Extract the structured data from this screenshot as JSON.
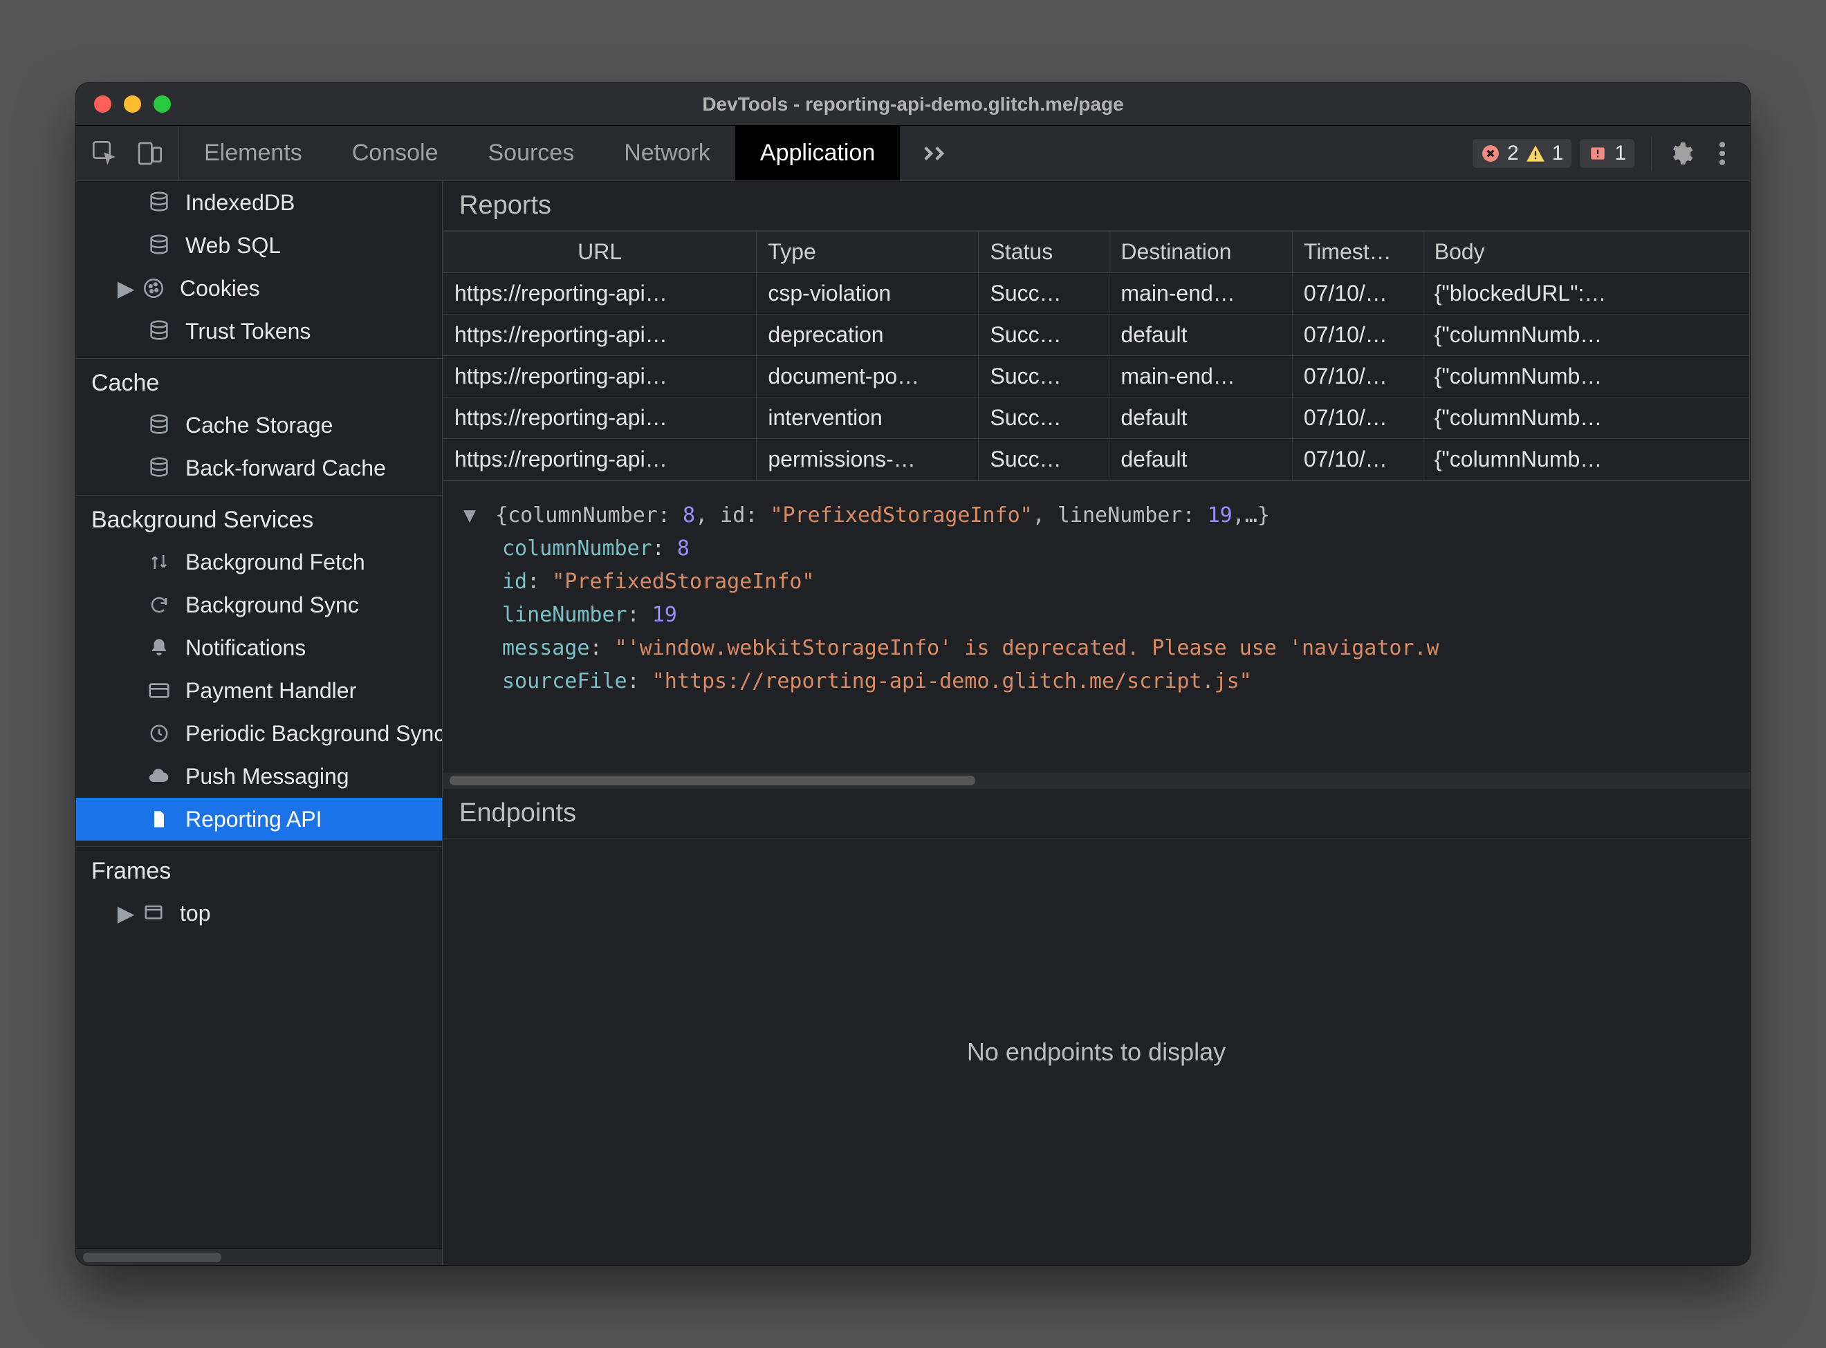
{
  "window": {
    "title": "DevTools - reporting-api-demo.glitch.me/page"
  },
  "toolbar": {
    "tabs": [
      "Elements",
      "Console",
      "Sources",
      "Network",
      "Application"
    ],
    "active_tab_index": 4,
    "errors_count": "2",
    "warnings_count": "1",
    "issues_count": "1"
  },
  "sidebar": {
    "storage_items": [
      {
        "icon": "database",
        "label": "IndexedDB",
        "level": 2
      },
      {
        "icon": "database",
        "label": "Web SQL",
        "level": 2
      },
      {
        "icon": "cookie",
        "label": "Cookies",
        "level": 2,
        "caret": true
      },
      {
        "icon": "database",
        "label": "Trust Tokens",
        "level": 2
      }
    ],
    "groups": [
      {
        "title": "Cache",
        "items": [
          {
            "icon": "database",
            "label": "Cache Storage"
          },
          {
            "icon": "database",
            "label": "Back-forward Cache"
          }
        ]
      },
      {
        "title": "Background Services",
        "items": [
          {
            "icon": "updown",
            "label": "Background Fetch"
          },
          {
            "icon": "sync",
            "label": "Background Sync"
          },
          {
            "icon": "bell",
            "label": "Notifications"
          },
          {
            "icon": "card",
            "label": "Payment Handler"
          },
          {
            "icon": "clock",
            "label": "Periodic Background Sync"
          },
          {
            "icon": "cloud",
            "label": "Push Messaging"
          },
          {
            "icon": "file",
            "label": "Reporting API",
            "selected": true
          }
        ]
      },
      {
        "title": "Frames",
        "items": [
          {
            "icon": "frame",
            "label": "top",
            "caret": true
          }
        ]
      }
    ]
  },
  "reports": {
    "title": "Reports",
    "columns": [
      "URL",
      "Type",
      "Status",
      "Destination",
      "Timest…",
      "Body"
    ],
    "rows": [
      {
        "url": "https://reporting-api…",
        "type": "csp-violation",
        "status": "Succ…",
        "destination": "main-end…",
        "timestamp": "07/10/…",
        "body": "{\"blockedURL\":…"
      },
      {
        "url": "https://reporting-api…",
        "type": "deprecation",
        "status": "Succ…",
        "destination": "default",
        "timestamp": "07/10/…",
        "body": "{\"columnNumb…"
      },
      {
        "url": "https://reporting-api…",
        "type": "document-po…",
        "status": "Succ…",
        "destination": "main-end…",
        "timestamp": "07/10/…",
        "body": "{\"columnNumb…"
      },
      {
        "url": "https://reporting-api…",
        "type": "intervention",
        "status": "Succ…",
        "destination": "default",
        "timestamp": "07/10/…",
        "body": "{\"columnNumb…"
      },
      {
        "url": "https://reporting-api…",
        "type": "permissions-…",
        "status": "Succ…",
        "destination": "default",
        "timestamp": "07/10/…",
        "body": "{\"columnNumb…"
      }
    ]
  },
  "detail": {
    "summary_prefix": "{columnNumber: ",
    "summary_col": "8",
    "summary_mid": ", id: ",
    "summary_id": "\"PrefixedStorageInfo\"",
    "summary_mid2": ", lineNumber: ",
    "summary_line": "19",
    "summary_suffix": ",…}",
    "k_columnNumber": "columnNumber",
    "v_columnNumber": "8",
    "k_id": "id",
    "v_id": "\"PrefixedStorageInfo\"",
    "k_lineNumber": "lineNumber",
    "v_lineNumber": "19",
    "k_message": "message",
    "v_message": "\"'window.webkitStorageInfo' is deprecated. Please use 'navigator.w",
    "k_sourceFile": "sourceFile",
    "v_sourceFile": "\"https://reporting-api-demo.glitch.me/script.js\""
  },
  "endpoints": {
    "title": "Endpoints",
    "empty_text": "No endpoints to display"
  }
}
